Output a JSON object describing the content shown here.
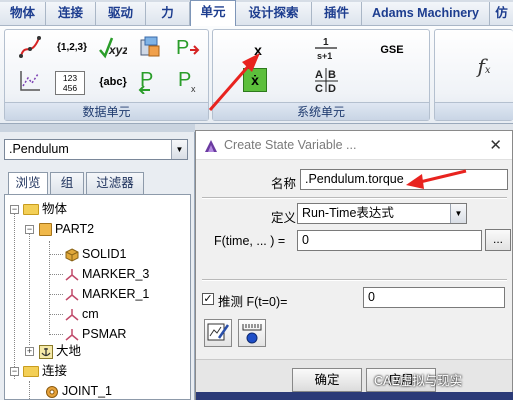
{
  "ribbon": {
    "tabs": [
      "物体",
      "连接",
      "驱动",
      "力",
      "单元",
      "设计探索",
      "插件",
      "Adams Machinery",
      "仿"
    ],
    "active_tab": "单元",
    "groups": {
      "data_elements": {
        "label": "数据单元",
        "icons": [
          {
            "name": "spline-icon",
            "text": ""
          },
          {
            "name": "array-icon",
            "text": "{1,2,3}"
          },
          {
            "name": "xyz-curve-icon",
            "text": "xyz"
          },
          {
            "name": "matrix-block-icon",
            "text": ""
          },
          {
            "name": "pinput-icon",
            "text": "P"
          },
          {
            "name": "curve-data-icon",
            "text": ""
          },
          {
            "name": "matrix-icon",
            "text": "123 456"
          },
          {
            "name": "string-icon",
            "text": "{abc}"
          },
          {
            "name": "poutput-icon",
            "text": "P"
          },
          {
            "name": "px-icon",
            "text": "P"
          }
        ]
      },
      "system_elements": {
        "label": "系统单元",
        "icons": [
          {
            "name": "state-variable-icon",
            "text": "x"
          },
          {
            "name": "transfer-function-icon",
            "text": "1 / s+1"
          },
          {
            "name": "gse-icon",
            "text": "GSE"
          },
          {
            "name": "diff-equation-icon",
            "text": "ẋ"
          },
          {
            "name": "linear-state-icon",
            "text": "A|B C|D"
          }
        ]
      },
      "function_group": {
        "icons": [
          {
            "name": "function-icon",
            "text": "fx"
          }
        ]
      }
    }
  },
  "left_panel": {
    "model_value": ".Pendulum",
    "subtabs": [
      "浏览",
      "组",
      "过滤器"
    ],
    "active_subtab": "浏览",
    "tree": [
      {
        "label": "物体",
        "kind": "folder",
        "expanded": true
      },
      {
        "label": "PART2",
        "kind": "part",
        "expanded": true
      },
      {
        "label": "SOLID1",
        "kind": "solid"
      },
      {
        "label": "MARKER_3",
        "kind": "marker"
      },
      {
        "label": "MARKER_1",
        "kind": "marker"
      },
      {
        "label": "cm",
        "kind": "marker"
      },
      {
        "label": "PSMAR",
        "kind": "marker"
      },
      {
        "label": "大地",
        "kind": "ground",
        "expanded": false
      },
      {
        "label": "连接",
        "kind": "folder",
        "expanded": true
      },
      {
        "label": "JOINT_1",
        "kind": "joint"
      }
    ]
  },
  "dialog": {
    "title": "Create State Variable ...",
    "name_label": "名称",
    "name_value": ".Pendulum.torque",
    "definition_label": "定义",
    "definition_value": "Run-Time表达式",
    "function_label": "F(time, ... ) =",
    "function_value": "0",
    "ellipsis_label": "...",
    "guess_checked": true,
    "guess_label": "推测 F(t=0)=",
    "guess_value": "0",
    "ok_label": "确定",
    "apply_label": "应用"
  },
  "watermark": "CAE虚拟与现实",
  "colors": {
    "accent": "#1d3d8f",
    "annotation_arrow": "#e8231f",
    "folder": "#f3cf56"
  }
}
